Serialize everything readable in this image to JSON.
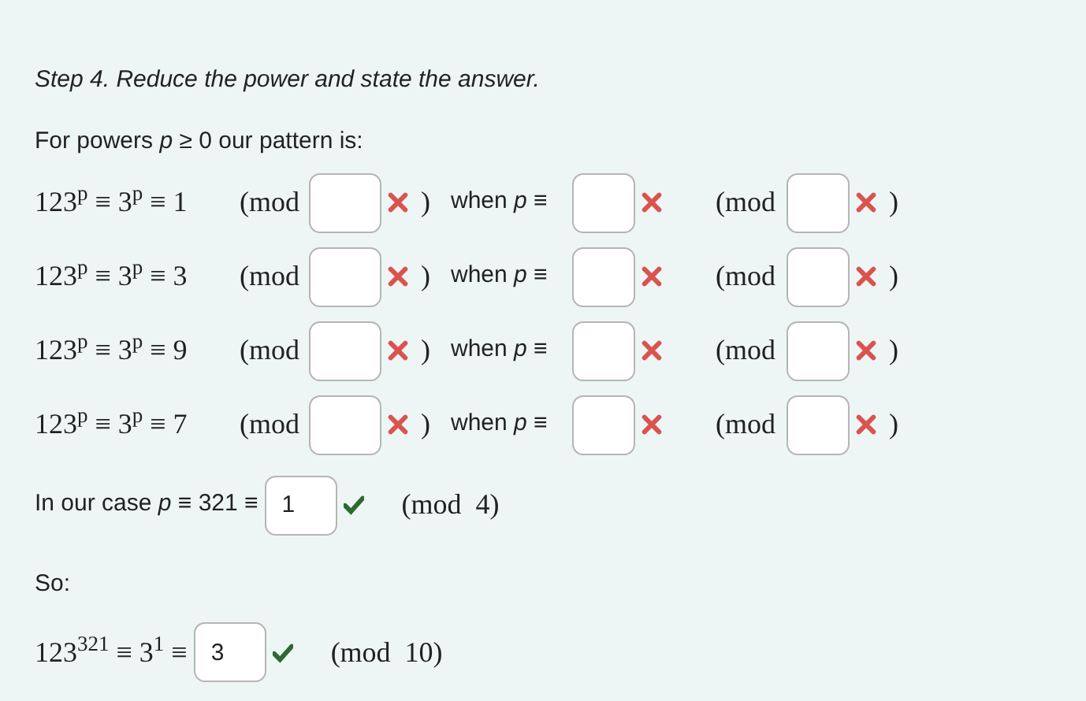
{
  "step_title": "Step 4. Reduce the power and state the answer.",
  "intro": "For powers *p* ≥ 0 our pattern is:",
  "pattern_rows": [
    {
      "lhs": "123$^{p}$ ≡ 3$^{p}$ ≡ 1",
      "mod_open": "(mod",
      "mod_field": {
        "correct": false
      },
      "mod_close": ")",
      "when": "when *p* ≡",
      "when_field": {
        "correct": false
      },
      "mod2_open": "(mod",
      "mod2_field": {
        "correct": false
      },
      "mod2_close": ")"
    },
    {
      "lhs": "123$^{p}$ ≡ 3$^{p}$ ≡ 3",
      "mod_open": "(mod",
      "mod_field": {
        "correct": false
      },
      "mod_close": ")",
      "when": "when *p* ≡",
      "when_field": {
        "correct": false
      },
      "mod2_open": "(mod",
      "mod2_field": {
        "correct": false
      },
      "mod2_close": ")"
    },
    {
      "lhs": "123$^{p}$ ≡ 3$^{p}$ ≡ 9",
      "mod_open": "(mod",
      "mod_field": {
        "correct": false
      },
      "mod_close": ")",
      "when": "when *p* ≡",
      "when_field": {
        "correct": false
      },
      "mod2_open": "(mod",
      "mod2_field": {
        "correct": false
      },
      "mod2_close": ")"
    },
    {
      "lhs": "123$^{p}$ ≡ 3$^{p}$ ≡ 7",
      "mod_open": "(mod",
      "mod_field": {
        "correct": false
      },
      "mod_close": ")",
      "when": "when *p* ≡",
      "when_field": {
        "correct": false
      },
      "mod2_open": "(mod",
      "mod2_field": {
        "correct": false
      },
      "mod2_close": ")"
    }
  ],
  "case_line": {
    "text": "In our case *p* ≡ 321 ≡",
    "field": {
      "value": "1",
      "correct": true
    },
    "mod": "(mod  4)"
  },
  "so": "So:",
  "answer_line": {
    "lhs": "123$^{321}$ ≡ 3$^{1}$ ≡",
    "field": {
      "value": "3",
      "correct": true
    },
    "mod": "(mod  10)"
  }
}
